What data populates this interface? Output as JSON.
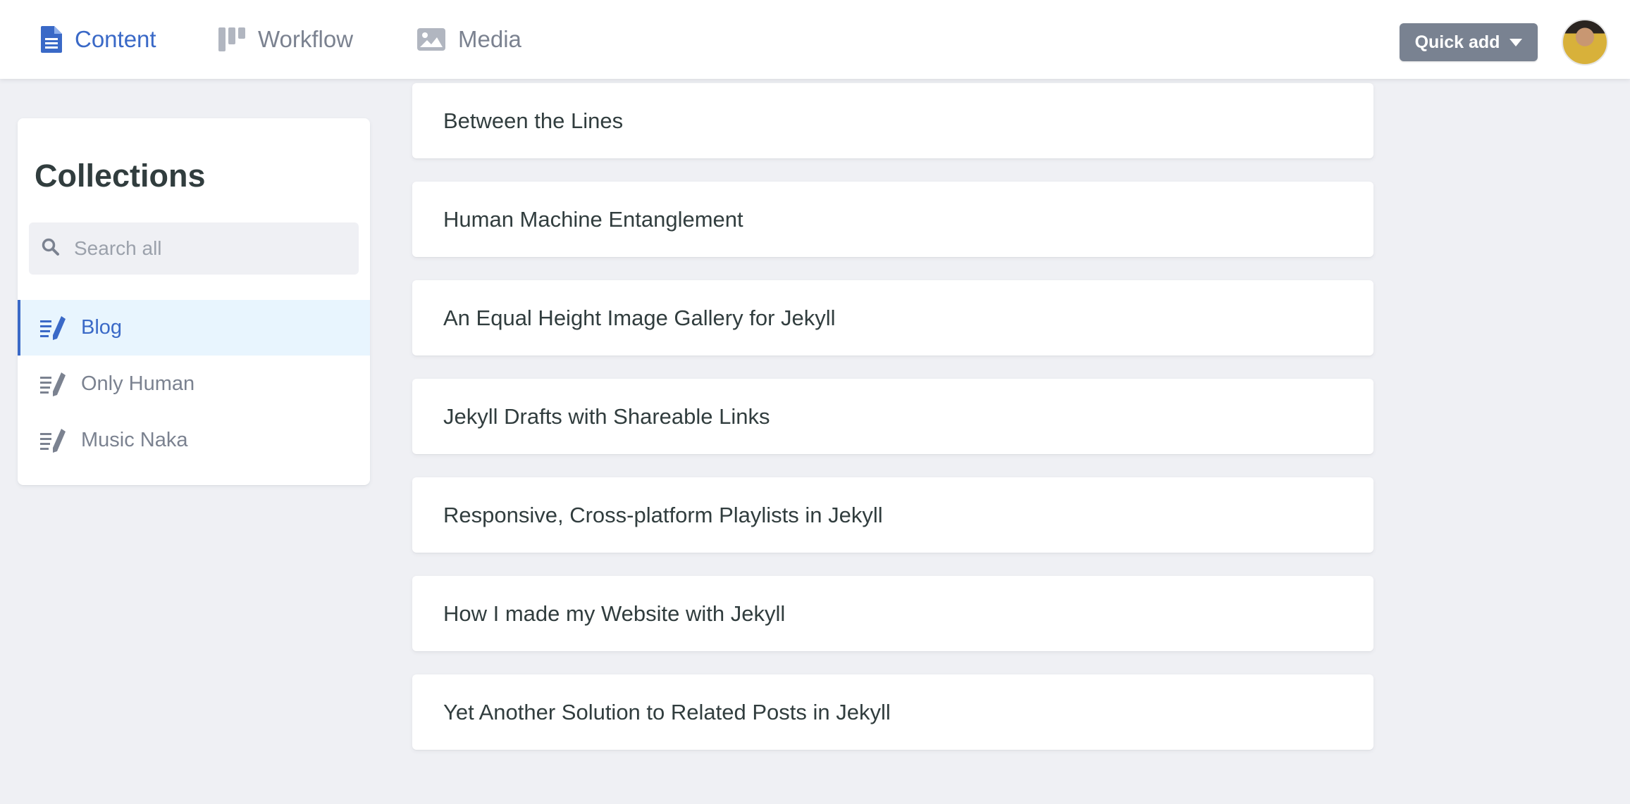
{
  "header": {
    "tabs": [
      {
        "label": "Content",
        "icon": "document-icon",
        "active": true
      },
      {
        "label": "Workflow",
        "icon": "workflow-icon",
        "active": false
      },
      {
        "label": "Media",
        "icon": "image-icon",
        "active": false
      }
    ],
    "quick_add_label": "Quick add",
    "accent_color": "#3a69c7",
    "button_color": "#798291"
  },
  "sidebar": {
    "title": "Collections",
    "search_placeholder": "Search all",
    "collections": [
      {
        "label": "Blog",
        "icon": "write-icon",
        "active": true
      },
      {
        "label": "Only Human",
        "icon": "write-icon",
        "active": false
      },
      {
        "label": "Music Naka",
        "icon": "write-icon",
        "active": false
      }
    ]
  },
  "entries": [
    {
      "title": "Between the Lines"
    },
    {
      "title": "Human Machine Entanglement"
    },
    {
      "title": "An Equal Height Image Gallery for Jekyll"
    },
    {
      "title": "Jekyll Drafts with Shareable Links"
    },
    {
      "title": "Responsive, Cross-platform Playlists in Jekyll"
    },
    {
      "title": "How I made my Website with Jekyll"
    },
    {
      "title": "Yet Another Solution to Related Posts in Jekyll"
    }
  ]
}
